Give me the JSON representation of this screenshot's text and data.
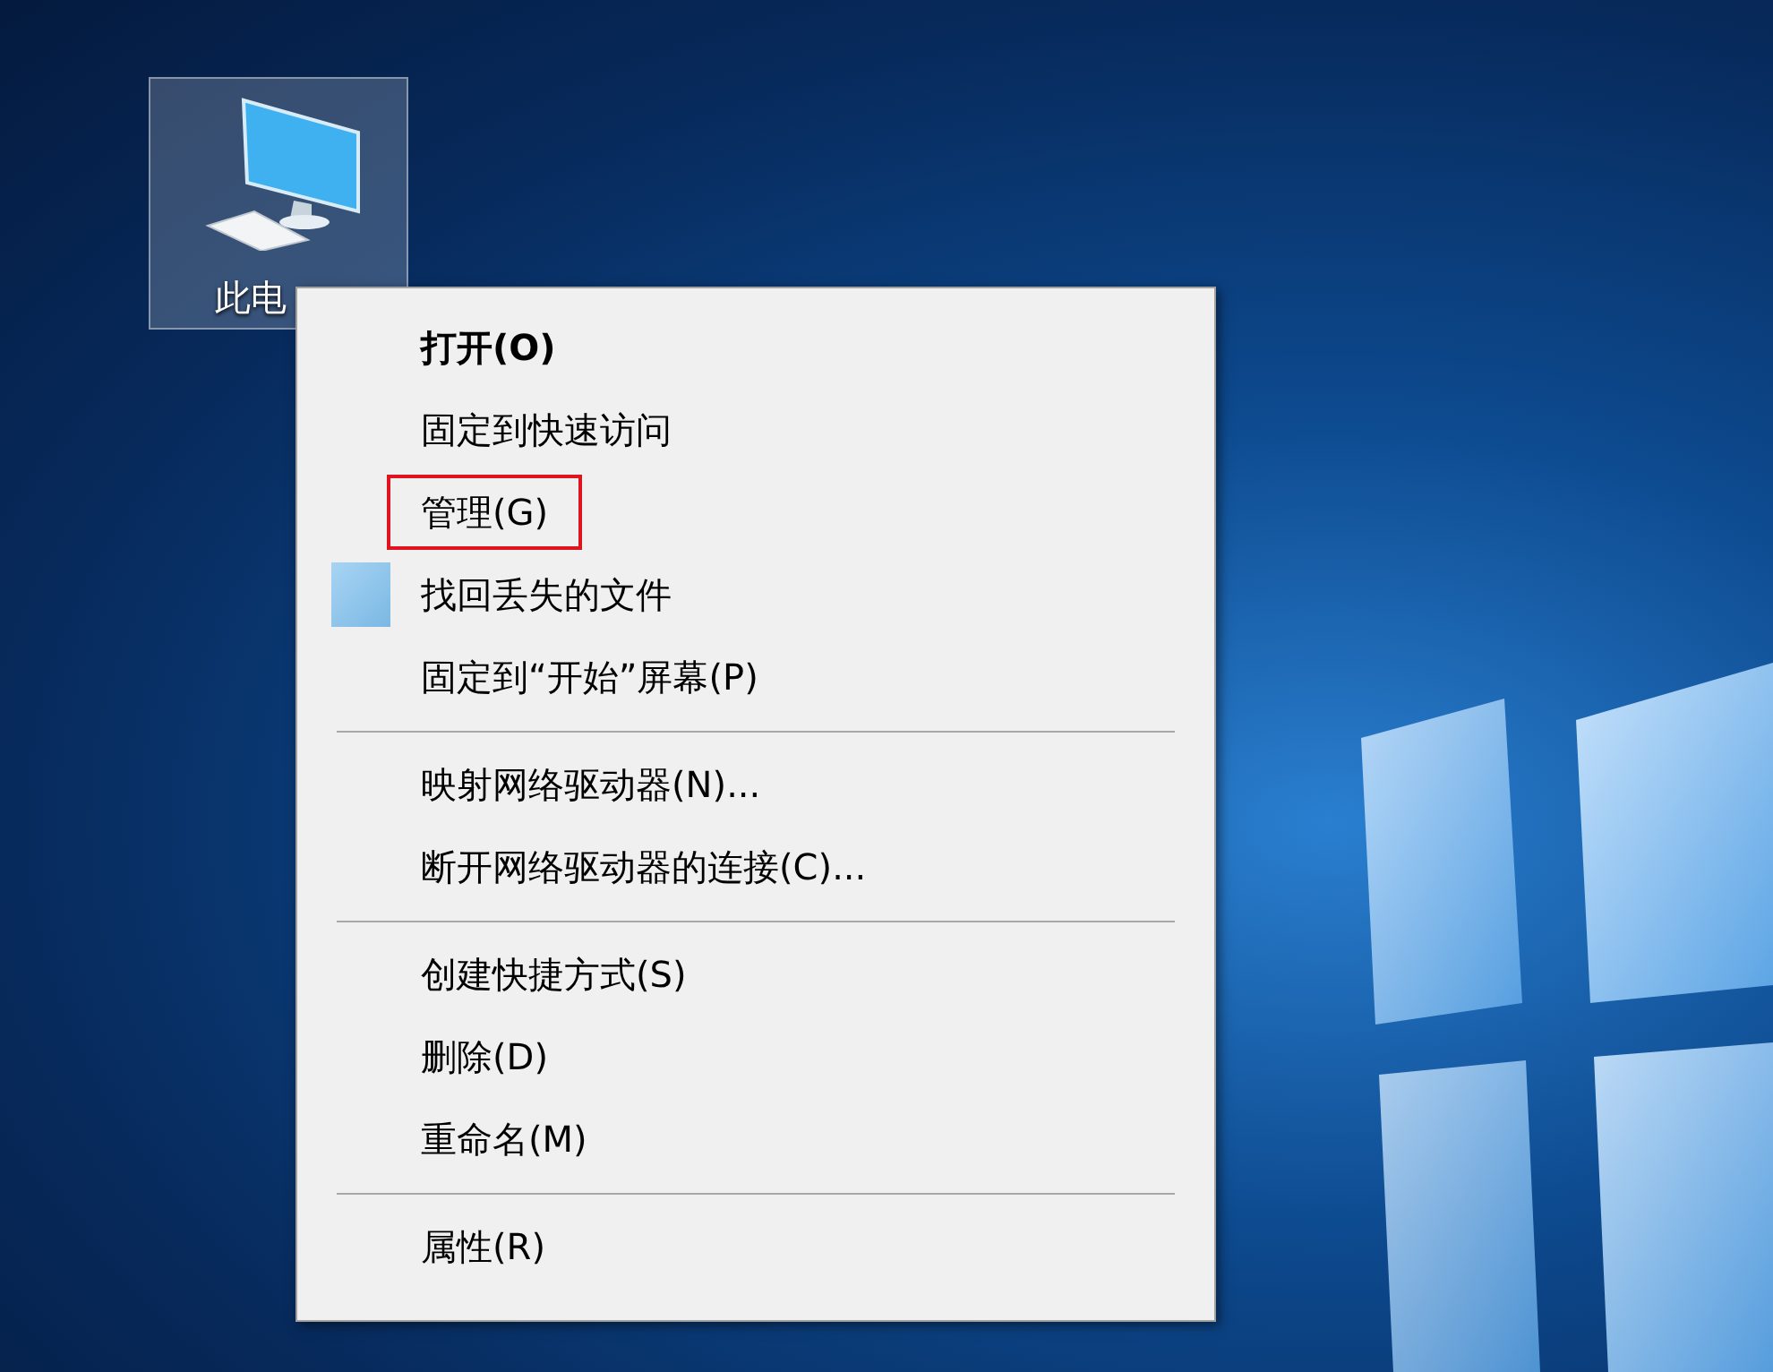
{
  "desktop_icon": {
    "label": "此电",
    "selected": true
  },
  "context_menu": {
    "items": [
      {
        "kind": "item",
        "label": "打开(O)",
        "default": true,
        "highlighted": false,
        "icon": false
      },
      {
        "kind": "item",
        "label": "固定到快速访问",
        "default": false,
        "highlighted": false,
        "icon": false
      },
      {
        "kind": "item",
        "label": "管理(G)",
        "default": false,
        "highlighted": true,
        "icon": false
      },
      {
        "kind": "item",
        "label": "找回丢失的文件",
        "default": false,
        "highlighted": false,
        "icon": true
      },
      {
        "kind": "item",
        "label": "固定到“开始”屏幕(P)",
        "default": false,
        "highlighted": false,
        "icon": false
      },
      {
        "kind": "separator"
      },
      {
        "kind": "item",
        "label": "映射网络驱动器(N)...",
        "default": false,
        "highlighted": false,
        "icon": false
      },
      {
        "kind": "item",
        "label": "断开网络驱动器的连接(C)...",
        "default": false,
        "highlighted": false,
        "icon": false
      },
      {
        "kind": "separator"
      },
      {
        "kind": "item",
        "label": "创建快捷方式(S)",
        "default": false,
        "highlighted": false,
        "icon": false
      },
      {
        "kind": "item",
        "label": "删除(D)",
        "default": false,
        "highlighted": false,
        "icon": false
      },
      {
        "kind": "item",
        "label": "重命名(M)",
        "default": false,
        "highlighted": false,
        "icon": false
      },
      {
        "kind": "separator"
      },
      {
        "kind": "item",
        "label": "属性(R)",
        "default": false,
        "highlighted": false,
        "icon": false
      }
    ]
  }
}
